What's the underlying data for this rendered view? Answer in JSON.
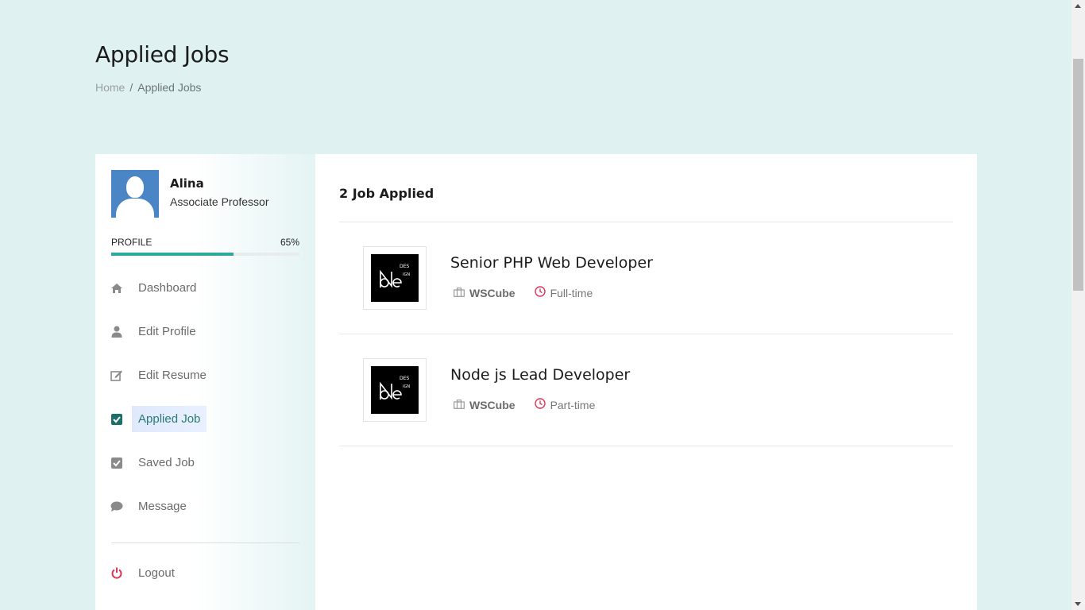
{
  "page": {
    "title": "Applied Jobs",
    "breadcrumb": {
      "home": "Home",
      "separator": "/",
      "current": "Applied Jobs"
    }
  },
  "profile": {
    "name": "Alina",
    "role": "Associate Professor",
    "progress_label": "PROFILE",
    "progress_value": "65%",
    "progress_fraction": 0.65
  },
  "menu": [
    {
      "label": "Dashboard",
      "icon": "home-icon"
    },
    {
      "label": "Edit Profile",
      "icon": "user-icon"
    },
    {
      "label": "Edit Resume",
      "icon": "edit-icon"
    },
    {
      "label": "Applied Job",
      "icon": "check-square-icon",
      "active": true
    },
    {
      "label": "Saved Job",
      "icon": "check-square-icon"
    },
    {
      "label": "Message",
      "icon": "comment-icon"
    }
  ],
  "logout": {
    "label": "Logout",
    "icon": "power-icon"
  },
  "main": {
    "count_title": "2 Job Applied",
    "jobs": [
      {
        "title": "Senior PHP Web Developer",
        "company": "WSCube",
        "type": "Full-time"
      },
      {
        "title": "Node js Lead Developer",
        "company": "WSCube",
        "type": "Part-time"
      }
    ]
  },
  "colors": {
    "background": "#dff1f0",
    "accent": "#2ea89f",
    "logout": "#e0345a",
    "clock": "#e0345a"
  }
}
